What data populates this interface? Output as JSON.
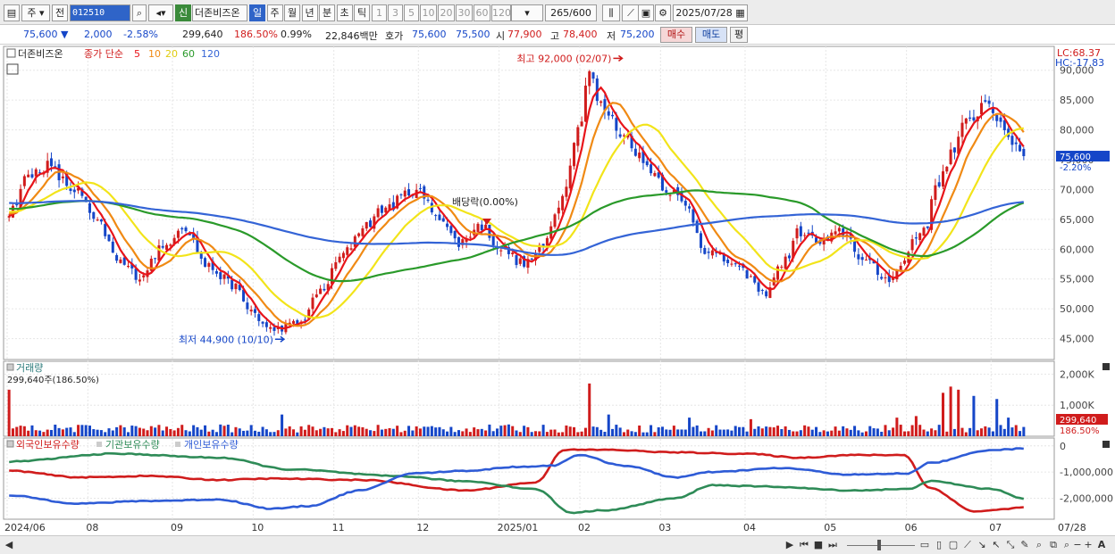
{
  "toolbar": {
    "period_selector": "주",
    "prev_label": "전",
    "stock_code": "012510",
    "stock_name": "더존비즈온",
    "new_badge": "신",
    "period_tabs": [
      "일",
      "주",
      "월",
      "년",
      "분",
      "초",
      "틱"
    ],
    "active_period": "일",
    "interval_buttons": [
      "1",
      "3",
      "5",
      "10",
      "20",
      "30",
      "60",
      "120"
    ],
    "count_value": "265",
    "count_total": "/600",
    "date_value": "2025/07/28"
  },
  "quote": {
    "price": "75,600",
    "change": "2,000",
    "change_pct": "-2.58%",
    "volume": "299,640",
    "volume_ratio": "186.50%",
    "turnover_pct": "0.99%",
    "amount": "22,846백만",
    "bid_label": "호가",
    "ask_price": "75,600",
    "bid_price": "75,500",
    "open_label": "시",
    "open_price": "77,900",
    "high_label": "고",
    "high_price": "78,400",
    "low_label": "저",
    "low_price": "75,200",
    "buy_label": "매수",
    "sell_label": "매도",
    "eval_label": "평"
  },
  "price_panel": {
    "stock_label": "더존비즈온",
    "legend_prefix": "종가 단순",
    "ma_periods": [
      "5",
      "10",
      "20",
      "60",
      "120"
    ],
    "lc_label": "LC:68.37",
    "hc_label": "HC:-17.83",
    "high_annotation": "최고 92,000 (02/07)",
    "low_annotation": "최저 44,900 (10/10)",
    "dividend_annotation": "배당락(0.00%)",
    "current_price_label": "75,600",
    "current_change_label": "-2.20%"
  },
  "volume_panel": {
    "title": "거래량",
    "value_label": "299,640주(186.50%)",
    "current_label": "299,640",
    "current_pct_label": "186.50%"
  },
  "holding_panel": {
    "legend": [
      "외국인보유수량",
      "기관보유수량",
      "개인보유수량"
    ]
  },
  "colors": {
    "up": "#d01c1c",
    "down": "#1546c8",
    "ma5": "#e8141a",
    "ma10": "#f08a14",
    "ma20": "#f2e41a",
    "ma60": "#2a9a2a",
    "ma120": "#3464d6",
    "foreign": "#d01c1c",
    "institution": "#2e8b57",
    "individual": "#2e5bd6"
  },
  "chart_data": [
    {
      "type": "candlestick",
      "title": "",
      "y_ticks": [
        45000,
        50000,
        55000,
        60000,
        65000,
        70000,
        75000,
        80000,
        85000,
        90000
      ],
      "y_tick_labels": [
        "45,000",
        "50,000",
        "55,000",
        "60,000",
        "65,000",
        "70,000",
        "75,000",
        "80,000",
        "85,000",
        "90,000"
      ],
      "ylim": [
        41500,
        94000
      ],
      "x_tick_labels": [
        "2024/06",
        "08",
        "09",
        "10",
        "11",
        "12",
        "2025/01",
        "02",
        "03",
        "04",
        "05",
        "06",
        "07",
        "07/28"
      ],
      "x_tick_index": [
        0,
        21,
        43,
        64,
        85,
        107,
        128,
        149,
        170,
        192,
        213,
        234,
        256,
        264
      ],
      "n_bars": 265,
      "close_anchors": [
        [
          0,
          66000
        ],
        [
          5,
          72000
        ],
        [
          10,
          74000
        ],
        [
          18,
          70000
        ],
        [
          25,
          64000
        ],
        [
          30,
          58000
        ],
        [
          36,
          55500
        ],
        [
          42,
          60000
        ],
        [
          48,
          64000
        ],
        [
          55,
          57000
        ],
        [
          62,
          54000
        ],
        [
          66,
          50000
        ],
        [
          72,
          46500
        ],
        [
          80,
          47500
        ],
        [
          86,
          53000
        ],
        [
          92,
          59000
        ],
        [
          98,
          64000
        ],
        [
          104,
          67000
        ],
        [
          112,
          70000
        ],
        [
          118,
          66000
        ],
        [
          124,
          61000
        ],
        [
          130,
          64000
        ],
        [
          136,
          60000
        ],
        [
          142,
          57500
        ],
        [
          147,
          60000
        ],
        [
          152,
          68000
        ],
        [
          157,
          80000
        ],
        [
          160,
          90000
        ],
        [
          163,
          84000
        ],
        [
          170,
          79000
        ],
        [
          176,
          74000
        ],
        [
          182,
          70000
        ],
        [
          187,
          67000
        ],
        [
          192,
          60000
        ],
        [
          198,
          58000
        ],
        [
          203,
          56000
        ],
        [
          208,
          52500
        ],
        [
          214,
          58000
        ],
        [
          218,
          63000
        ],
        [
          224,
          61000
        ],
        [
          230,
          63000
        ],
        [
          236,
          58000
        ],
        [
          242,
          55000
        ],
        [
          246,
          57000
        ],
        [
          250,
          62000
        ],
        [
          253,
          64000
        ],
        [
          256,
          71000
        ],
        [
          260,
          76000
        ],
        [
          264,
          81000
        ],
        [
          270,
          85000
        ],
        [
          275,
          79000
        ],
        [
          281,
          75600
        ]
      ],
      "ma_series": [
        {
          "name": "5",
          "period": 5
        },
        {
          "name": "10",
          "period": 10
        },
        {
          "name": "20",
          "period": 20
        },
        {
          "name": "60",
          "period": 60
        },
        {
          "name": "120",
          "period": 120
        }
      ],
      "high_point": {
        "index": 160,
        "value": 92000
      },
      "low_point": {
        "index": 72,
        "value": 44900
      }
    },
    {
      "type": "bar",
      "series": [
        {
          "name": "거래량"
        }
      ],
      "y_ticks": [
        1000000,
        2000000
      ],
      "y_tick_labels": [
        "1,000K",
        "2,000K"
      ],
      "ylim": [
        0,
        2300000
      ],
      "spikes": [
        [
          0,
          1500000
        ],
        [
          75,
          700000
        ],
        [
          160,
          1700000
        ],
        [
          165,
          700000
        ],
        [
          188,
          600000
        ],
        [
          205,
          550000
        ],
        [
          245,
          600000
        ],
        [
          250,
          650000
        ],
        [
          258,
          1400000
        ],
        [
          260,
          1600000
        ],
        [
          262,
          1500000
        ],
        [
          266,
          1300000
        ],
        [
          272,
          1200000
        ],
        [
          276,
          600000
        ]
      ],
      "current_value": 299640
    },
    {
      "type": "line",
      "series": [
        {
          "name": "외국인보유수량",
          "anchors": [
            [
              0,
              -950000
            ],
            [
              20,
              -1200000
            ],
            [
              40,
              -1150000
            ],
            [
              60,
              -1300000
            ],
            [
              75,
              -1250000
            ],
            [
              100,
              -1300000
            ],
            [
              130,
              -1700000
            ],
            [
              150,
              -1400000
            ],
            [
              158,
              -150000
            ],
            [
              170,
              -150000
            ],
            [
              190,
              -250000
            ],
            [
              210,
              -300000
            ],
            [
              225,
              -450000
            ],
            [
              240,
              -350000
            ],
            [
              255,
              -350000
            ],
            [
              262,
              -1600000
            ],
            [
              275,
              -2500000
            ],
            [
              290,
              -2350000
            ]
          ]
        },
        {
          "name": "기관보유수량",
          "anchors": [
            [
              0,
              -600000
            ],
            [
              30,
              -300000
            ],
            [
              60,
              -450000
            ],
            [
              80,
              -900000
            ],
            [
              110,
              -1150000
            ],
            [
              130,
              -1350000
            ],
            [
              150,
              -1650000
            ],
            [
              160,
              -2550000
            ],
            [
              170,
              -2450000
            ],
            [
              190,
              -2000000
            ],
            [
              200,
              -1500000
            ],
            [
              215,
              -1550000
            ],
            [
              240,
              -1700000
            ],
            [
              256,
              -1650000
            ],
            [
              262,
              -1350000
            ],
            [
              280,
              -1650000
            ],
            [
              290,
              -2050000
            ]
          ]
        },
        {
          "name": "개인보유수량",
          "anchors": [
            [
              0,
              -1900000
            ],
            [
              20,
              -2200000
            ],
            [
              40,
              -2100000
            ],
            [
              60,
              -2050000
            ],
            [
              75,
              -2400000
            ],
            [
              85,
              -2300000
            ],
            [
              100,
              -1700000
            ],
            [
              115,
              -1050000
            ],
            [
              130,
              -950000
            ],
            [
              145,
              -800000
            ],
            [
              155,
              -750000
            ],
            [
              162,
              -350000
            ],
            [
              175,
              -750000
            ],
            [
              190,
              -1200000
            ],
            [
              200,
              -1000000
            ],
            [
              220,
              -850000
            ],
            [
              240,
              -1100000
            ],
            [
              256,
              -1050000
            ],
            [
              262,
              -650000
            ],
            [
              280,
              -150000
            ],
            [
              290,
              -100000
            ]
          ]
        }
      ],
      "y_ticks": [
        0,
        -1000000,
        -2000000
      ],
      "y_tick_labels": [
        "0",
        "-1,000,000",
        "-2,000,000"
      ],
      "ylim": [
        -2800000,
        300000
      ]
    }
  ]
}
